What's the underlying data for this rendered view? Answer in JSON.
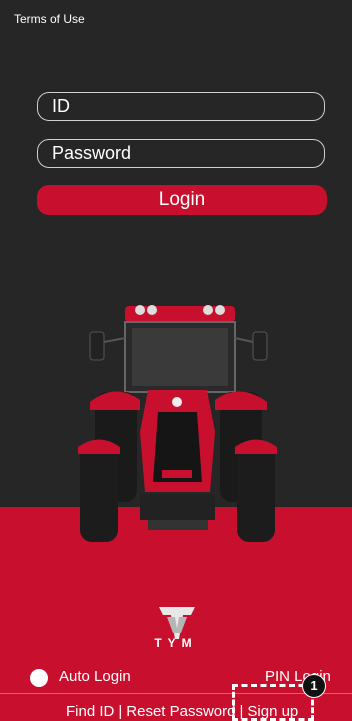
{
  "header": {
    "terms_label": "Terms of Use"
  },
  "form": {
    "id_placeholder": "ID",
    "password_placeholder": "Password",
    "login_label": "Login"
  },
  "brand": {
    "name": "TYM"
  },
  "options": {
    "auto_login_label": "Auto Login",
    "pin_login_label": "PIN Login"
  },
  "footer": {
    "find_id": "Find ID",
    "separator": "|",
    "reset_password": "Reset Password",
    "sign_up": "Sign up"
  },
  "annotation": {
    "marker_number": "1"
  },
  "colors": {
    "accent": "#c8102e",
    "background": "#262626",
    "text": "#ffffff"
  },
  "icons": {
    "brand_logo": "tym-logo",
    "tractor": "tractor-image"
  }
}
